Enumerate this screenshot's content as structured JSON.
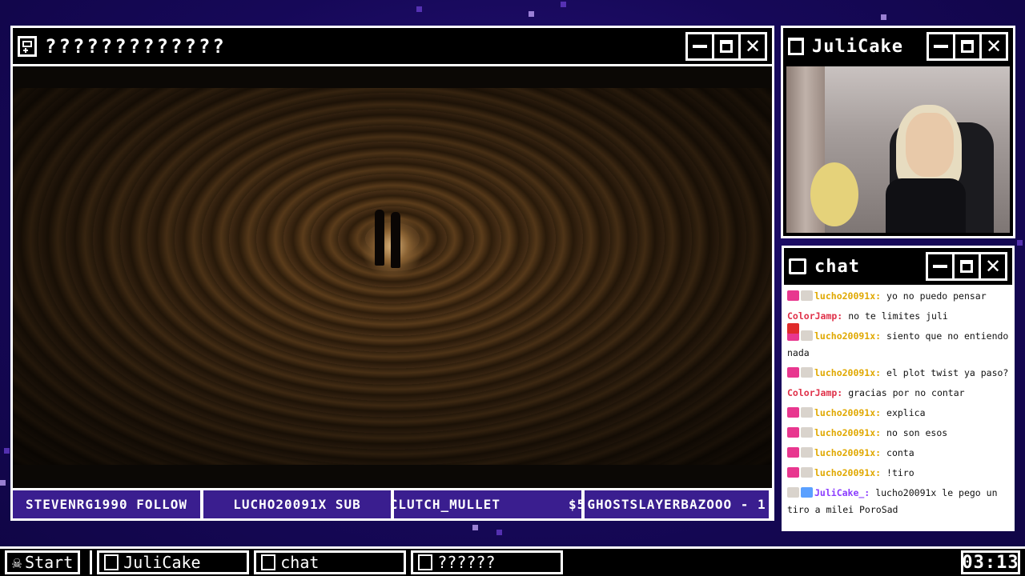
{
  "main_window": {
    "title": "?????????????",
    "icon": "gameboy-icon"
  },
  "ticker": [
    {
      "text": "STEVENRG1990 FOLLOW"
    },
    {
      "text": "LUCHO20091X SUB"
    },
    {
      "text": "CLUTCH_MULLET        $5"
    },
    {
      "text": "GHOSTSLAYERBAZOOO - 1"
    }
  ],
  "cam_window": {
    "title": "JuliCake",
    "icon": "trash-icon"
  },
  "chat_window": {
    "title": "chat",
    "icon": "speech-bubble-icon",
    "messages": [
      {
        "user": "lucho20091x:",
        "text": "yo no puedo pensar",
        "color": "#e0a800",
        "badges": [
          "heart",
          "pet"
        ]
      },
      {
        "user": "ColorJamp:",
        "text": "no te limites juli",
        "color": "#e0324a",
        "badges": []
      },
      {
        "user": "lucho20091x:",
        "text": "siento que no entiendo nada",
        "color": "#e0a800",
        "badges": [
          "heart",
          "pet"
        ]
      },
      {
        "user": "lucho20091x:",
        "text": "el plot twist ya paso?",
        "color": "#e0a800",
        "badges": [
          "heart",
          "pet"
        ]
      },
      {
        "user": "ColorJamp:",
        "text": "gracias por no contar",
        "color": "#e0324a",
        "badges": []
      },
      {
        "user": "lucho20091x:",
        "text": "explica",
        "color": "#e0a800",
        "badges": [
          "heart",
          "pet"
        ]
      },
      {
        "user": "lucho20091x:",
        "text": "no son esos",
        "color": "#e0a800",
        "badges": [
          "heart",
          "pet"
        ]
      },
      {
        "user": "lucho20091x:",
        "text": "conta",
        "color": "#e0a800",
        "badges": [
          "heart",
          "pet"
        ]
      },
      {
        "user": "lucho20091x:",
        "text": "!tiro",
        "color": "#e0a800",
        "badges": [
          "heart",
          "pet"
        ]
      },
      {
        "user": "JuliCake_:",
        "text": "lucho20091x le pego un tiro a milei PoroSad",
        "color": "#8a3cff",
        "badges": [
          "cam",
          "pet",
          "gift"
        ]
      }
    ]
  },
  "taskbar": {
    "start_label": "Start",
    "buttons": [
      {
        "label": "JuliCake",
        "icon": "trash-icon"
      },
      {
        "label": "chat",
        "icon": "speech-bubble-icon"
      },
      {
        "label": "??????",
        "icon": "gameboy-icon"
      }
    ],
    "clock": "03:13"
  },
  "colors": {
    "background": "#1a0b5e",
    "ticker": "#3a1e8f",
    "accent": "#8a3cff"
  }
}
